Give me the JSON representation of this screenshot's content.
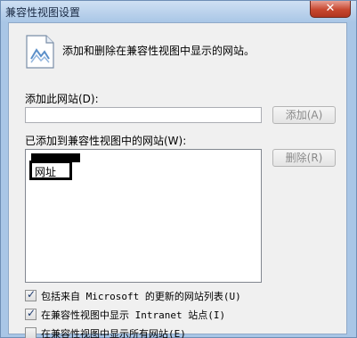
{
  "window": {
    "title": "兼容性视图设置",
    "close_glyph": "✕"
  },
  "header": {
    "text": "添加和删除在兼容性视图中显示的网站。"
  },
  "add_section": {
    "label": "添加此网站(D):",
    "input_value": "",
    "add_button": "添加(A)"
  },
  "list_section": {
    "label": "已添加到兼容性视图中的网站(W):",
    "items": [
      "网址"
    ],
    "delete_button": "删除(R)"
  },
  "options": [
    {
      "label": "包括来自 Microsoft 的更新的网站列表(U)",
      "checked": true
    },
    {
      "label": "在兼容性视图中显示 Intranet 站点(I)",
      "checked": true
    },
    {
      "label": "在兼容性视图中显示所有网站(E)",
      "checked": false
    }
  ],
  "colors": {
    "frame": "#a9c6e6",
    "client": "#f0f0f0",
    "close_button": "#c7472f"
  }
}
